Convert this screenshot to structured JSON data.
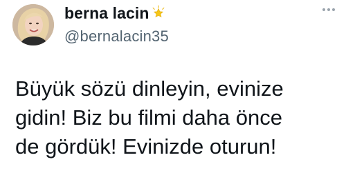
{
  "author": {
    "display_name": "berna lacin",
    "badge_icon": "star-icon",
    "handle": "@bernalacin35"
  },
  "menu": {
    "icon": "more-options-icon"
  },
  "tweet": {
    "text": "Büyük sözü dinleyin, evinize\ngidin! Biz bu filmi daha önce\nde gördük! Evinizde oturun!"
  },
  "colors": {
    "text": "#0f1419",
    "secondary": "#536471",
    "background": "#ffffff",
    "star": "#f5c518"
  }
}
